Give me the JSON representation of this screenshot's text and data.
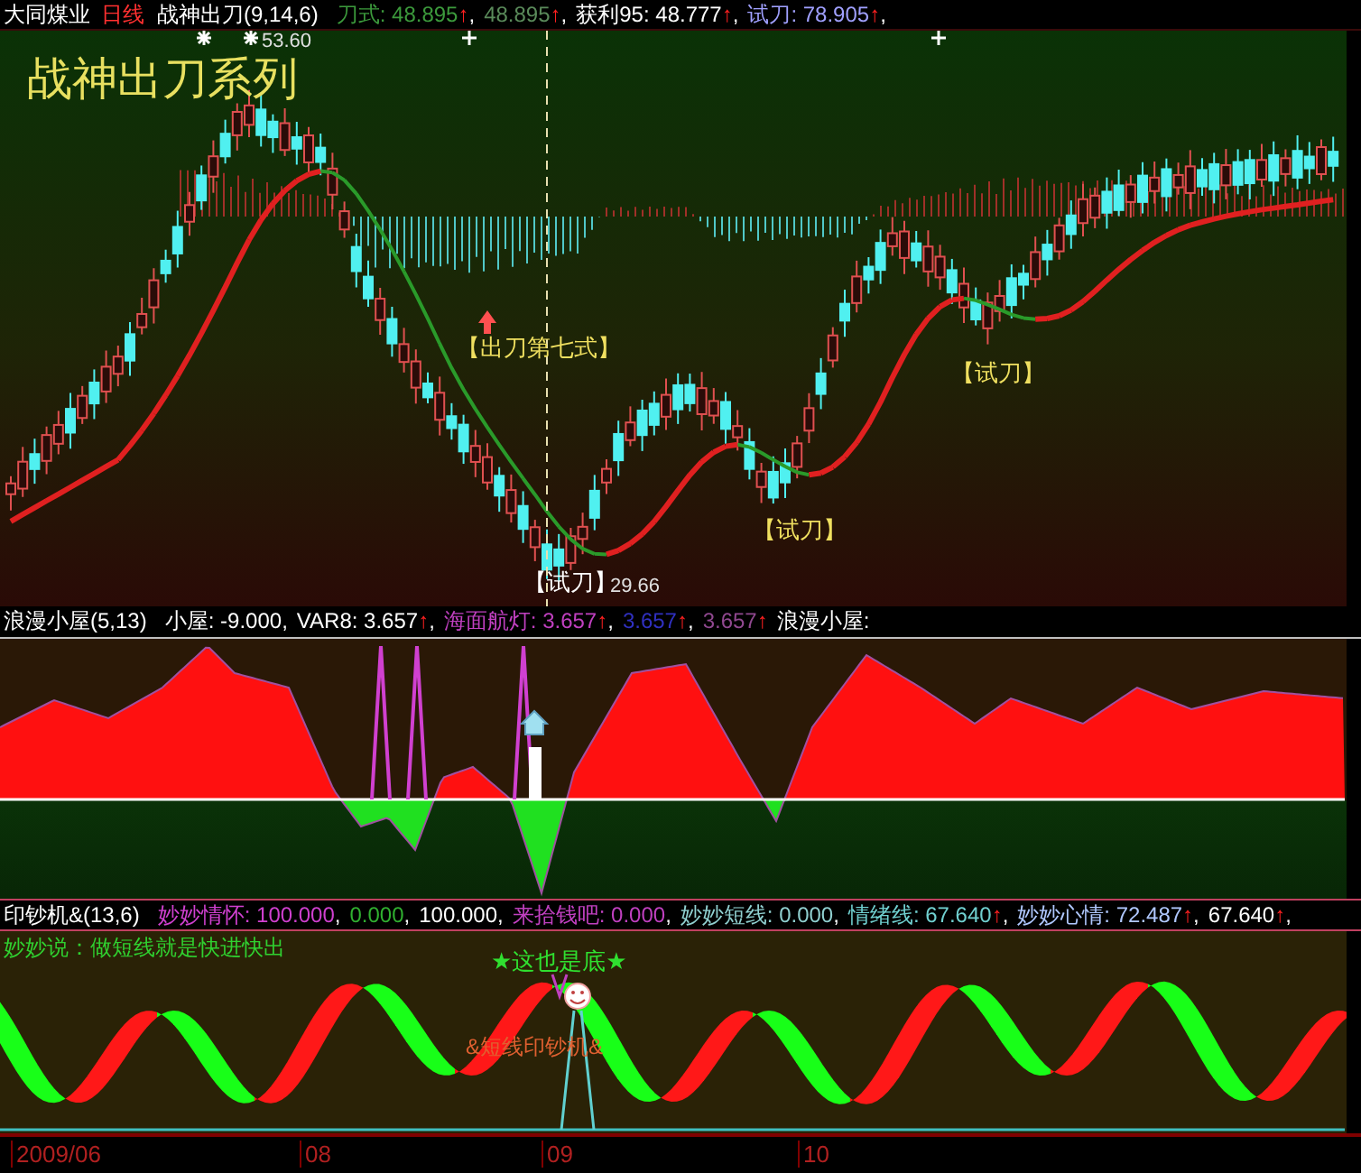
{
  "main_panel": {
    "header": [
      {
        "kind": "stock",
        "text": "大同煤业",
        "color": "#ffffff"
      },
      {
        "kind": "period",
        "text": "日线",
        "color": "#ff3030"
      },
      {
        "kind": "indicator",
        "text": "战神出刀(9,14,6)",
        "color": "#ffffff"
      },
      {
        "kind": "value",
        "text": "刀式: 48.895",
        "arrow": "↑",
        "suffix": ",",
        "color": "#3c9a3c"
      },
      {
        "kind": "value",
        "text": "48.895",
        "arrow": "↑",
        "suffix": ",",
        "color": "#5a8a5a"
      },
      {
        "kind": "value",
        "text": "获利95: 48.777",
        "arrow": "↑",
        "suffix": ",",
        "color": "#ffffff"
      },
      {
        "kind": "value",
        "text": "试刀: 78.905",
        "arrow": "↑",
        "suffix": ",",
        "color": "#a0a0ff"
      }
    ],
    "annotations": [
      {
        "kind": "title",
        "text": "战神出刀系列"
      },
      {
        "kind": "price",
        "text": "53.60"
      },
      {
        "kind": "signal",
        "text": "【出刀第七式】"
      },
      {
        "kind": "signal",
        "text": "【试刀】"
      },
      {
        "kind": "signal",
        "text": "【试刀】"
      },
      {
        "kind": "low_signal",
        "text": "【试刀】"
      },
      {
        "kind": "price",
        "text": "29.66"
      }
    ]
  },
  "second_panel": {
    "header": [
      {
        "kind": "indicator",
        "text": "浪漫小屋(5,13)",
        "color": "#ffffff"
      },
      {
        "kind": "value",
        "text": "小屋: -9.000",
        "suffix": ",",
        "color": "#ffffff"
      },
      {
        "kind": "value",
        "text": "VAR8: 3.657",
        "arrow": "↑",
        "suffix": ",",
        "color": "#ffffff"
      },
      {
        "kind": "value",
        "text": "海面航灯: 3.657",
        "arrow": "↑",
        "suffix": ",",
        "color": "#c040c0"
      },
      {
        "kind": "value",
        "text": "3.657",
        "arrow": "↑",
        "suffix": ",",
        "color": "#3030c0"
      },
      {
        "kind": "value",
        "text": "3.657",
        "arrow": "↑",
        "color": "#904890"
      },
      {
        "kind": "value",
        "text": "浪漫小屋:",
        "color": "#ffffff"
      }
    ]
  },
  "third_panel": {
    "header": [
      {
        "kind": "indicator",
        "text": "印钞机&(13,6)",
        "color": "#ffffff"
      },
      {
        "kind": "value",
        "text": "妙妙情怀: 100.000",
        "suffix": ",",
        "color": "#d040d0"
      },
      {
        "kind": "value",
        "text": "0.000",
        "suffix": ",",
        "color": "#30b030"
      },
      {
        "kind": "value",
        "text": "100.000",
        "suffix": ",",
        "color": "#ffffff"
      },
      {
        "kind": "value",
        "text": "来拾钱吧: 0.000",
        "suffix": ",",
        "color": "#c040c0"
      },
      {
        "kind": "value",
        "text": "妙妙短线: 0.000",
        "suffix": ",",
        "color": "#90d0d0"
      },
      {
        "kind": "value",
        "text": "情绪线: 67.640",
        "arrow": "↑",
        "suffix": ",",
        "color": "#70d0d0"
      },
      {
        "kind": "value",
        "text": "妙妙心情: 72.487",
        "arrow": "↑",
        "suffix": ",",
        "color": "#b0c8ff"
      },
      {
        "kind": "value",
        "text": "67.640",
        "arrow": "↑",
        "suffix": ",",
        "color": "#ffffff"
      }
    ],
    "note": "妙妙说：做短线就是快进快出",
    "annotations": [
      {
        "kind": "bottom",
        "text": "★这也是底★"
      },
      {
        "kind": "machine",
        "text": "&短线印钞机&"
      }
    ]
  },
  "time_axis": [
    "2009/06",
    "08",
    "09",
    "10"
  ]
}
